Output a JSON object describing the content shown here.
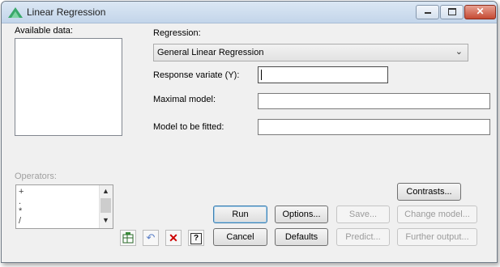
{
  "window": {
    "title": "Linear Regression"
  },
  "labels": {
    "available_data": "Available data:",
    "regression": "Regression:",
    "response_variate": "Response variate (Y):",
    "maximal_model": "Maximal model:",
    "model_to_fit": "Model to be fitted:",
    "operators": "Operators:"
  },
  "regression_select": {
    "value": "General Linear Regression"
  },
  "fields": {
    "response_variate": "",
    "maximal_model": "",
    "model_to_fit": ""
  },
  "operators": [
    "+",
    ".",
    "*",
    "/"
  ],
  "buttons": {
    "contrasts": "Contrasts...",
    "run": "Run",
    "options": "Options...",
    "save": "Save...",
    "change_model": "Change model...",
    "cancel": "Cancel",
    "defaults": "Defaults",
    "predict": "Predict...",
    "further_output": "Further output..."
  },
  "icons": {
    "app": "regression-triangle-icon",
    "send_to_spreadsheet": "spreadsheet-icon",
    "undo": "undo-icon",
    "clear": "clear-x-icon",
    "help": "help-icon"
  },
  "colors": {
    "default_button_border": "#3c7fb1",
    "clear_icon": "#cc0000",
    "undo_icon": "#5b7fc7"
  }
}
